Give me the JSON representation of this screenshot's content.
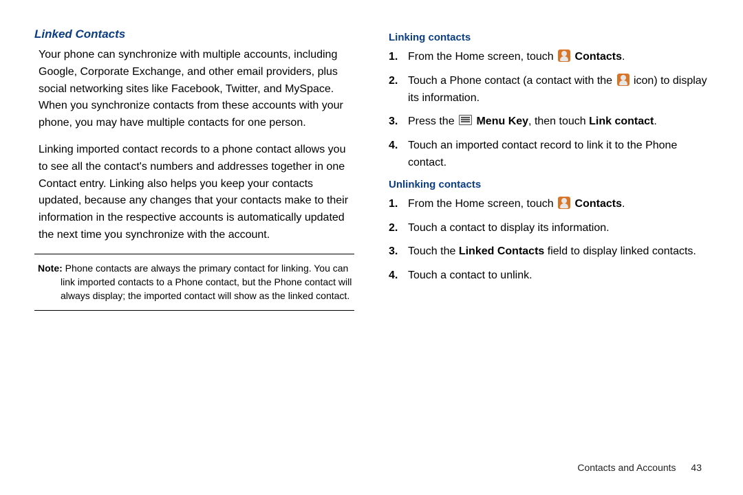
{
  "left": {
    "heading": "Linked Contacts",
    "para1": "Your phone can synchronize with multiple accounts, including Google, Corporate Exchange, and other email providers, plus social networking sites like Facebook, Twitter, and MySpace. When you synchronize contacts from these accounts with your phone, you may have multiple contacts for one person.",
    "para2": "Linking imported contact records to a phone contact allows you to see all the contact's numbers and addresses together in one Contact entry. Linking also helps you keep your contacts updated, because any changes that your contacts make to their information in the respective accounts is automatically updated the next time you synchronize with the account.",
    "note_label": "Note:",
    "note_text": "Phone contacts are always the primary contact for linking. You can link imported contacts to a Phone contact, but the Phone contact will always display; the imported contact will show as the linked contact."
  },
  "right": {
    "section1_heading": "Linking contacts",
    "s1_1_a": "From the Home screen, touch ",
    "s1_1_b": " Contacts",
    "s1_1_c": ".",
    "s1_2_a": "Touch a Phone contact (a contact with the ",
    "s1_2_b": " icon) to display its information.",
    "s1_3_a": "Press the ",
    "s1_3_b": " Menu Key",
    "s1_3_c": ", then touch ",
    "s1_3_d": "Link contact",
    "s1_3_e": ".",
    "s1_4": "Touch an imported contact record to link it to the Phone contact.",
    "section2_heading": "Unlinking contacts",
    "s2_1_a": "From the Home screen, touch ",
    "s2_1_b": " Contacts",
    "s2_1_c": ".",
    "s2_2": "Touch a contact to display its information.",
    "s2_3_a": "Touch the ",
    "s2_3_b": "Linked Contacts",
    "s2_3_c": " field to display linked contacts.",
    "s2_4": "Touch a contact to unlink."
  },
  "footer": {
    "section": "Contacts and Accounts",
    "page": "43"
  }
}
